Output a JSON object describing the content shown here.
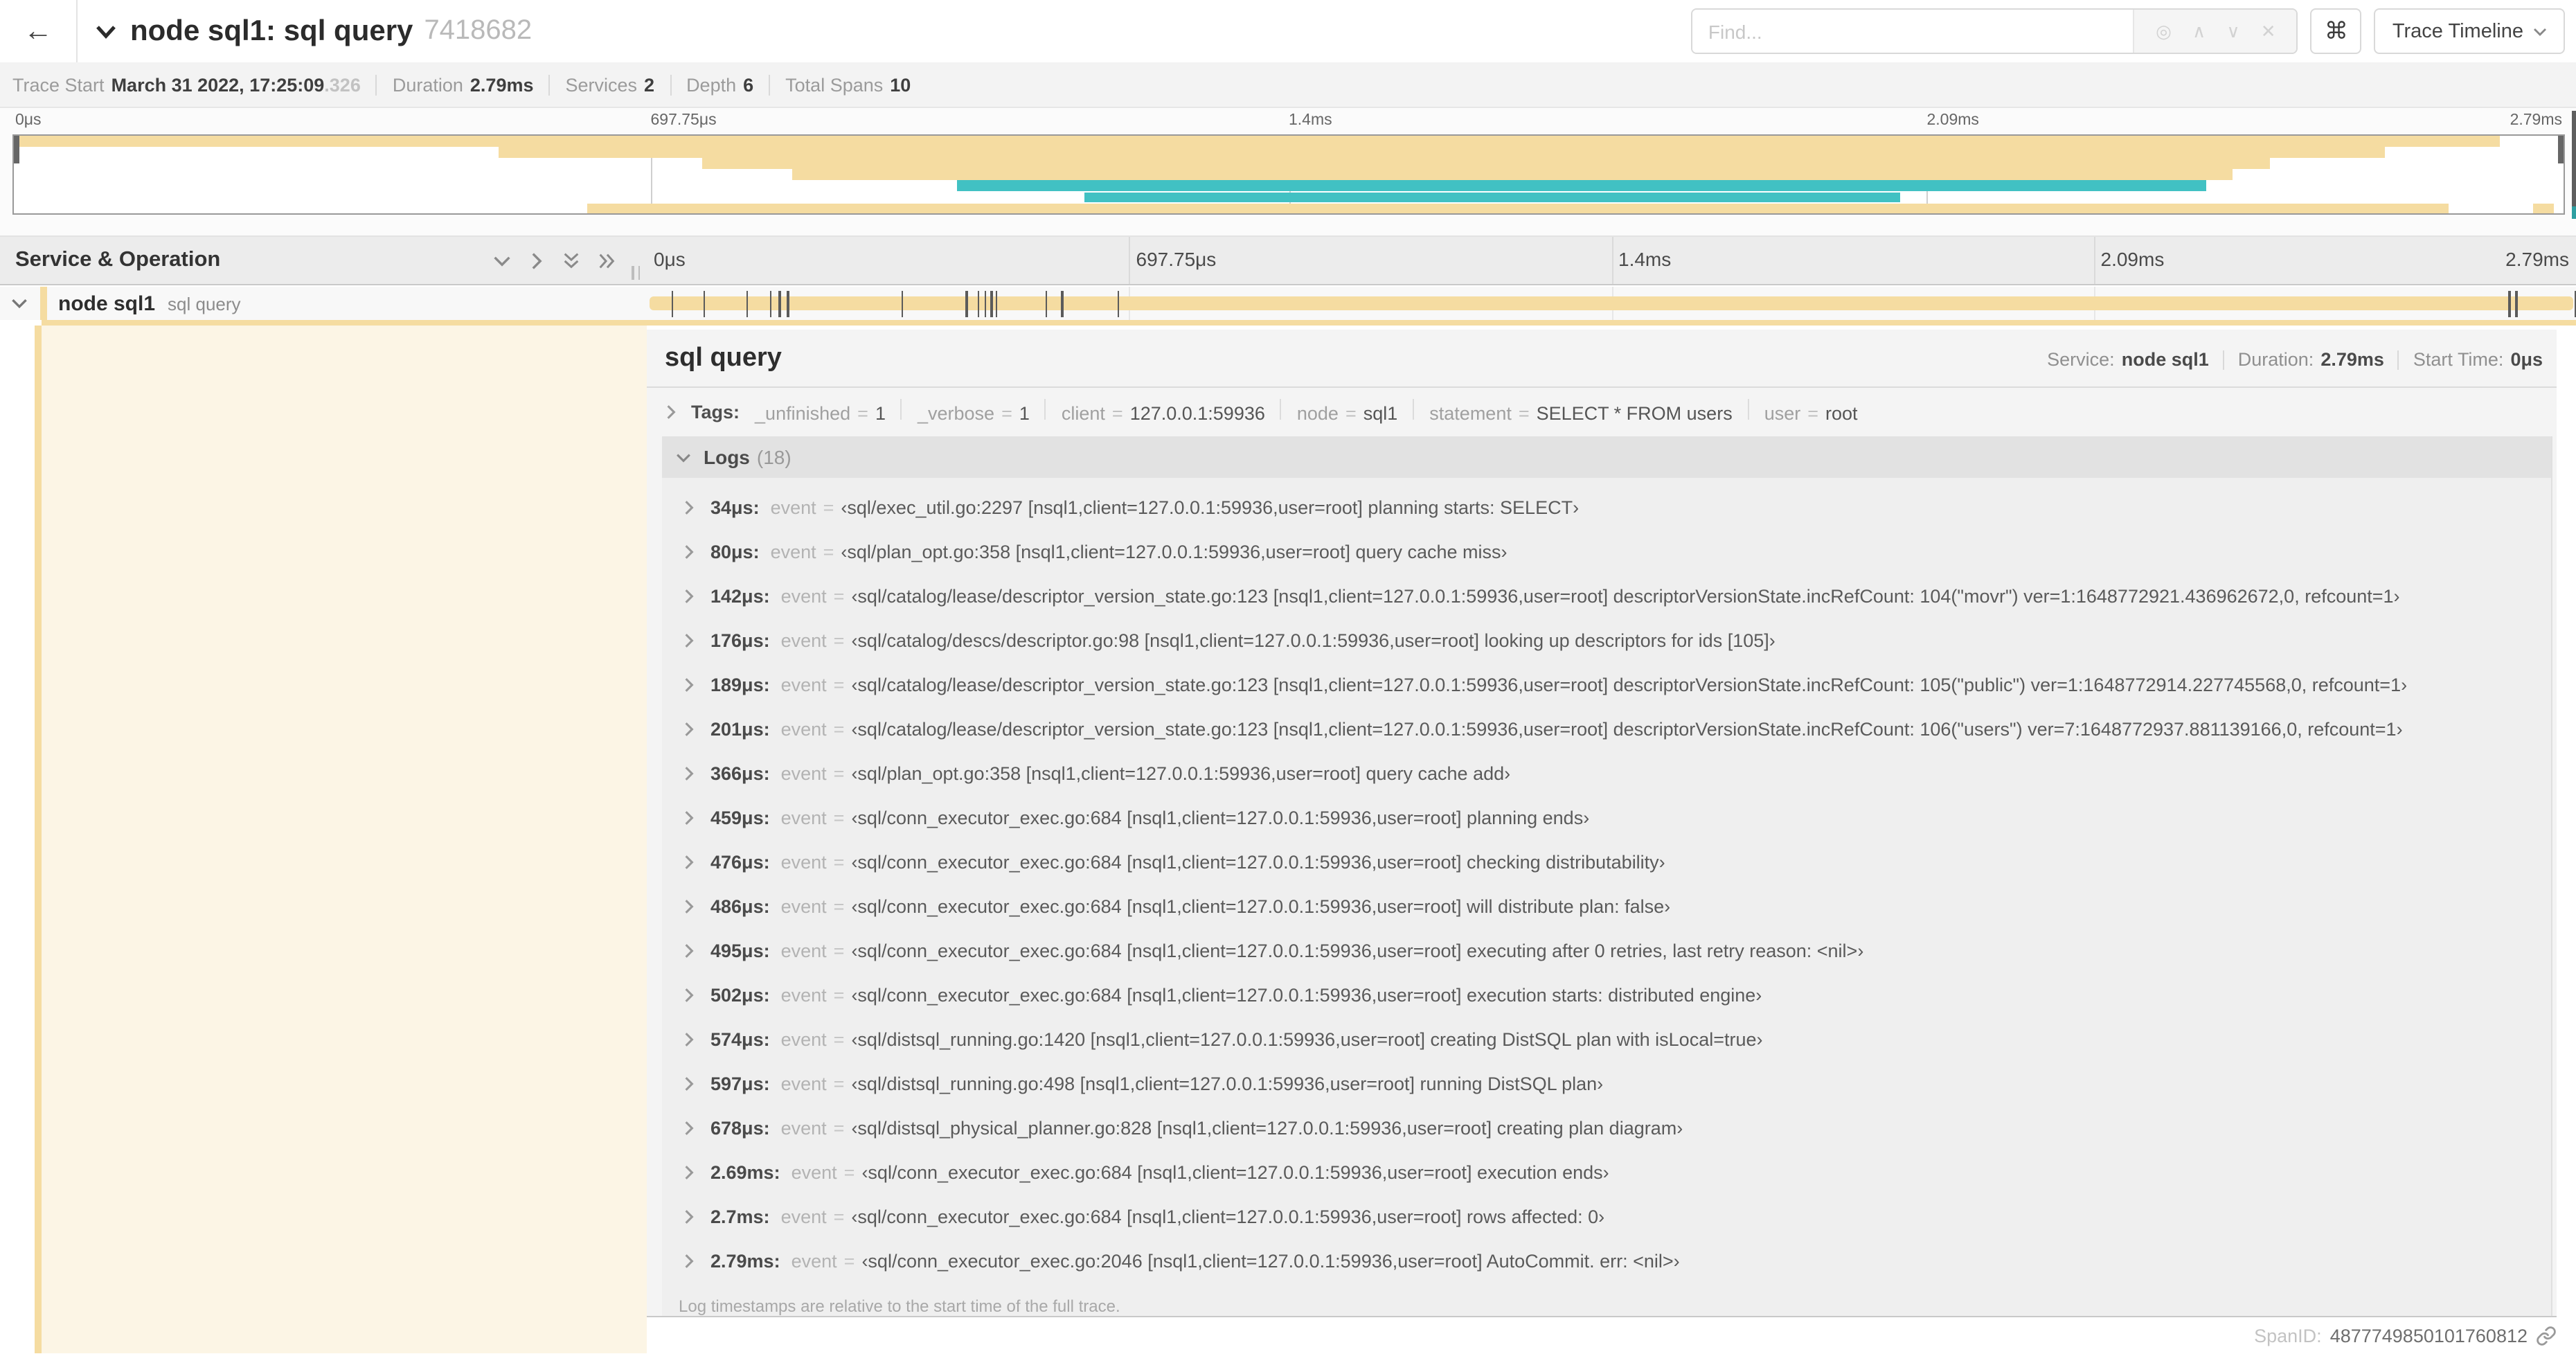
{
  "colors": {
    "span_tan": "#f5dca1",
    "span_teal": "#41c1c3",
    "cream": "#fcf5e5"
  },
  "icons": {
    "back_arrow": "←",
    "locate": "◎",
    "prev_match": "∧",
    "next_match": "∨",
    "clear_search": "✕",
    "command_key": "⌘"
  },
  "header": {
    "title": "node sql1: sql query",
    "trace_id_short": "7418682",
    "find_placeholder": "Find...",
    "view_dropdown": "Trace Timeline"
  },
  "meta": {
    "items": [
      {
        "label": "Trace Start",
        "value": "March 31 2022, 17:25:09",
        "suffix": ".326"
      },
      {
        "label": "Duration",
        "value": "2.79ms"
      },
      {
        "label": "Services",
        "value": "2"
      },
      {
        "label": "Depth",
        "value": "6"
      },
      {
        "label": "Total Spans",
        "value": "10"
      }
    ]
  },
  "timeline": {
    "service_operation_label": "Service & Operation",
    "duration_us": 2790,
    "tick_labels": [
      {
        "text": "0μs",
        "pct": 0
      },
      {
        "text": "697.75μs",
        "pct": 25
      },
      {
        "text": "1.4ms",
        "pct": 50
      },
      {
        "text": "2.09ms",
        "pct": 75
      },
      {
        "text": "2.79ms",
        "pct": 100
      }
    ],
    "gridlines_pct": [
      25,
      50,
      75
    ],
    "minimap_bars": [
      {
        "row": 0,
        "start": 0,
        "end": 97.5,
        "color": "tan"
      },
      {
        "row": 1,
        "start": 19,
        "end": 93,
        "color": "tan"
      },
      {
        "row": 2,
        "start": 27,
        "end": 88.5,
        "color": "tan"
      },
      {
        "row": 3,
        "start": 30.5,
        "end": 87,
        "color": "tan"
      },
      {
        "row": 4,
        "start": 37,
        "end": 86,
        "color": "teal"
      },
      {
        "row": 5,
        "start": 42,
        "end": 74,
        "color": "teal",
        "inset": 1
      },
      {
        "row": 6,
        "start": 22.5,
        "end": 95.5,
        "color": "tan",
        "inset": 1
      },
      {
        "row": 6,
        "start": 98.8,
        "end": 99.6,
        "color": "tan",
        "inset": 1
      }
    ]
  },
  "span_row": {
    "service": "node sql1",
    "operation": "sql query"
  },
  "detail": {
    "operation": "sql query",
    "info": [
      {
        "label": "Service:",
        "value": "node sql1"
      },
      {
        "label": "Duration:",
        "value": "2.79ms"
      },
      {
        "label": "Start Time:",
        "value": "0μs"
      }
    ],
    "tags_label": "Tags:",
    "tags": [
      {
        "key": "_unfinished",
        "value": "1"
      },
      {
        "key": "_verbose",
        "value": "1"
      },
      {
        "key": "client",
        "value": "127.0.0.1:59936"
      },
      {
        "key": "node",
        "value": "sql1"
      },
      {
        "key": "statement",
        "value": "SELECT * FROM users"
      },
      {
        "key": "user",
        "value": "root"
      }
    ],
    "logs_label": "Logs",
    "logs_count": "(18)",
    "logs": [
      {
        "time": "34μs",
        "key": "event",
        "value": "sql/exec_util.go:2297 [nsql1,client=127.0.0.1:59936,user=root] planning starts: SELECT"
      },
      {
        "time": "80μs",
        "key": "event",
        "value": "sql/plan_opt.go:358 [nsql1,client=127.0.0.1:59936,user=root] query cache miss"
      },
      {
        "time": "142μs",
        "key": "event",
        "value": "sql/catalog/lease/descriptor_version_state.go:123 [nsql1,client=127.0.0.1:59936,user=root] descriptorVersionState.incRefCount: 104(\"movr\") ver=1:1648772921.436962672,0, refcount=1"
      },
      {
        "time": "176μs",
        "key": "event",
        "value": "sql/catalog/descs/descriptor.go:98 [nsql1,client=127.0.0.1:59936,user=root] looking up descriptors for ids [105]"
      },
      {
        "time": "189μs",
        "key": "event",
        "value": "sql/catalog/lease/descriptor_version_state.go:123 [nsql1,client=127.0.0.1:59936,user=root] descriptorVersionState.incRefCount: 105(\"public\") ver=1:1648772914.227745568,0, refcount=1"
      },
      {
        "time": "201μs",
        "key": "event",
        "value": "sql/catalog/lease/descriptor_version_state.go:123 [nsql1,client=127.0.0.1:59936,user=root] descriptorVersionState.incRefCount: 106(\"users\") ver=7:1648772937.881139166,0, refcount=1"
      },
      {
        "time": "366μs",
        "key": "event",
        "value": "sql/plan_opt.go:358 [nsql1,client=127.0.0.1:59936,user=root] query cache add"
      },
      {
        "time": "459μs",
        "key": "event",
        "value": "sql/conn_executor_exec.go:684 [nsql1,client=127.0.0.1:59936,user=root] planning ends"
      },
      {
        "time": "476μs",
        "key": "event",
        "value": "sql/conn_executor_exec.go:684 [nsql1,client=127.0.0.1:59936,user=root] checking distributability"
      },
      {
        "time": "486μs",
        "key": "event",
        "value": "sql/conn_executor_exec.go:684 [nsql1,client=127.0.0.1:59936,user=root] will distribute plan: false"
      },
      {
        "time": "495μs",
        "key": "event",
        "value": "sql/conn_executor_exec.go:684 [nsql1,client=127.0.0.1:59936,user=root] executing after 0 retries, last retry reason: <nil>"
      },
      {
        "time": "502μs",
        "key": "event",
        "value": "sql/conn_executor_exec.go:684 [nsql1,client=127.0.0.1:59936,user=root] execution starts: distributed engine"
      },
      {
        "time": "574μs",
        "key": "event",
        "value": "sql/distsql_running.go:1420 [nsql1,client=127.0.0.1:59936,user=root] creating DistSQL plan with isLocal=true"
      },
      {
        "time": "597μs",
        "key": "event",
        "value": "sql/distsql_running.go:498 [nsql1,client=127.0.0.1:59936,user=root] running DistSQL plan"
      },
      {
        "time": "678μs",
        "key": "event",
        "value": "sql/distsql_physical_planner.go:828 [nsql1,client=127.0.0.1:59936,user=root] creating plan diagram"
      },
      {
        "time": "2.69ms",
        "key": "event",
        "value": "sql/conn_executor_exec.go:684 [nsql1,client=127.0.0.1:59936,user=root] execution ends"
      },
      {
        "time": "2.7ms",
        "key": "event",
        "value": "sql/conn_executor_exec.go:684 [nsql1,client=127.0.0.1:59936,user=root] rows affected: 0"
      },
      {
        "time": "2.79ms",
        "key": "event",
        "value": "sql/conn_executor_exec.go:2046 [nsql1,client=127.0.0.1:59936,user=root] AutoCommit. err: <nil>"
      }
    ],
    "logs_footnote": "Log timestamps are relative to the start time of the full trace.",
    "spanid_label": "SpanID:",
    "spanid_value": "4877749850101760812"
  }
}
